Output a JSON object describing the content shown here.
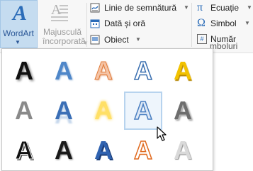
{
  "ribbon": {
    "wordart": {
      "label": "WordArt",
      "icon": "wordart-icon"
    },
    "dropcap": {
      "label_line1": "Majusculă",
      "label_line2": "încorporată",
      "icon": "drop-cap-icon"
    },
    "commands": {
      "signature_line": "Linie de semnătură",
      "date_time": "Dată și oră",
      "object": "Obiect"
    },
    "symbols": {
      "equation": "Ecuație",
      "symbol": "Simbol",
      "number": "Număr",
      "group_label": "mboluri"
    }
  },
  "gallery": {
    "rows": [
      [
        {
          "letter": "A",
          "style": "black-shadow"
        },
        {
          "letter": "A",
          "style": "blue-gradient"
        },
        {
          "letter": "A",
          "style": "orange-outline"
        },
        {
          "letter": "A",
          "style": "blue-outline"
        },
        {
          "letter": "A",
          "style": "gold"
        }
      ],
      [
        {
          "letter": "A",
          "style": "gray-gradient"
        },
        {
          "letter": "A",
          "style": "blue-reflection"
        },
        {
          "letter": "A",
          "style": "yellow-glow"
        },
        {
          "letter": "A",
          "style": "blue-outline-fill",
          "selected": true
        },
        {
          "letter": "A",
          "style": "gray-bevel"
        }
      ],
      [
        {
          "letter": "A",
          "style": "black-outline"
        },
        {
          "letter": "A",
          "style": "black-dark"
        },
        {
          "letter": "A",
          "style": "blue-bevel"
        },
        {
          "letter": "A",
          "style": "orange-white"
        },
        {
          "letter": "A",
          "style": "silver"
        }
      ]
    ]
  },
  "colors": {
    "accent": "#2b6cb8",
    "selected_bg": "#c5dcf0"
  }
}
